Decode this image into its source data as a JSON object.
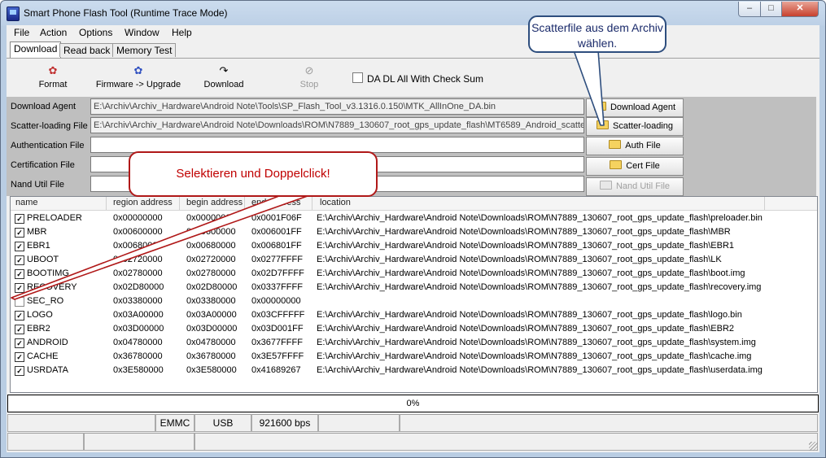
{
  "window": {
    "title": "Smart Phone Flash Tool (Runtime Trace Mode)",
    "controls": {
      "minimize": "–",
      "maximize": "□",
      "close": "✕"
    }
  },
  "menu": [
    "File",
    "Action",
    "Options",
    "Window",
    "Help"
  ],
  "tabs": [
    {
      "label": "Download",
      "active": true
    },
    {
      "label": "Read back",
      "active": false
    },
    {
      "label": "Memory Test",
      "active": false
    }
  ],
  "toolbar": {
    "format": "Format",
    "firmware_upgrade": "Firmware -> Upgrade",
    "download": "Download",
    "stop": "Stop",
    "checksum_label": "DA DL All With Check Sum",
    "checksum_checked": false
  },
  "files": {
    "download_agent": {
      "label": "Download Agent",
      "value": "E:\\Archiv\\Archiv_Hardware\\Android Note\\Tools\\SP_Flash_Tool_v3.1316.0.150\\MTK_AllInOne_DA.bin",
      "button": "Download Agent"
    },
    "scatter": {
      "label": "Scatter-loading File",
      "value": "E:\\Archiv\\Archiv_Hardware\\Android Note\\Downloads\\ROM\\N7889_130607_root_gps_update_flash\\MT6589_Android_scatte",
      "button": "Scatter-loading"
    },
    "auth": {
      "label": "Authentication File",
      "value": "",
      "button": "Auth File"
    },
    "cert": {
      "label": "Certification File",
      "value": "",
      "button": "Cert File"
    },
    "nand": {
      "label": "Nand Util File",
      "value": "",
      "button": "Nand Util File"
    }
  },
  "list": {
    "columns": [
      "name",
      "region address",
      "begin address",
      "end address",
      "location"
    ],
    "rows": [
      {
        "checked": true,
        "name": "PRELOADER",
        "region": "0x00000000",
        "begin": "0x00000000",
        "end": "0x0001F06F",
        "location": "E:\\Archiv\\Archiv_Hardware\\Android Note\\Downloads\\ROM\\N7889_130607_root_gps_update_flash\\preloader.bin"
      },
      {
        "checked": true,
        "name": "MBR",
        "region": "0x00600000",
        "begin": "0x00600000",
        "end": "0x006001FF",
        "location": "E:\\Archiv\\Archiv_Hardware\\Android Note\\Downloads\\ROM\\N7889_130607_root_gps_update_flash\\MBR"
      },
      {
        "checked": true,
        "name": "EBR1",
        "region": "0x00680000",
        "begin": "0x00680000",
        "end": "0x006801FF",
        "location": "E:\\Archiv\\Archiv_Hardware\\Android Note\\Downloads\\ROM\\N7889_130607_root_gps_update_flash\\EBR1"
      },
      {
        "checked": true,
        "name": "UBOOT",
        "region": "0x02720000",
        "begin": "0x02720000",
        "end": "0x0277FFFF",
        "location": "E:\\Archiv\\Archiv_Hardware\\Android Note\\Downloads\\ROM\\N7889_130607_root_gps_update_flash\\LK"
      },
      {
        "checked": true,
        "name": "BOOTIMG",
        "region": "0x02780000",
        "begin": "0x02780000",
        "end": "0x02D7FFFF",
        "location": "E:\\Archiv\\Archiv_Hardware\\Android Note\\Downloads\\ROM\\N7889_130607_root_gps_update_flash\\boot.img"
      },
      {
        "checked": true,
        "name": "RECOVERY",
        "region": "0x02D80000",
        "begin": "0x02D80000",
        "end": "0x0337FFFF",
        "location": "E:\\Archiv\\Archiv_Hardware\\Android Note\\Downloads\\ROM\\N7889_130607_root_gps_update_flash\\recovery.img"
      },
      {
        "checked": false,
        "name": "SEC_RO",
        "region": "0x03380000",
        "begin": "0x03380000",
        "end": "0x00000000",
        "location": ""
      },
      {
        "checked": true,
        "name": "LOGO",
        "region": "0x03A00000",
        "begin": "0x03A00000",
        "end": "0x03CFFFFF",
        "location": "E:\\Archiv\\Archiv_Hardware\\Android Note\\Downloads\\ROM\\N7889_130607_root_gps_update_flash\\logo.bin"
      },
      {
        "checked": true,
        "name": "EBR2",
        "region": "0x03D00000",
        "begin": "0x03D00000",
        "end": "0x03D001FF",
        "location": "E:\\Archiv\\Archiv_Hardware\\Android Note\\Downloads\\ROM\\N7889_130607_root_gps_update_flash\\EBR2"
      },
      {
        "checked": true,
        "name": "ANDROID",
        "region": "0x04780000",
        "begin": "0x04780000",
        "end": "0x3677FFFF",
        "location": "E:\\Archiv\\Archiv_Hardware\\Android Note\\Downloads\\ROM\\N7889_130607_root_gps_update_flash\\system.img"
      },
      {
        "checked": true,
        "name": "CACHE",
        "region": "0x36780000",
        "begin": "0x36780000",
        "end": "0x3E57FFFF",
        "location": "E:\\Archiv\\Archiv_Hardware\\Android Note\\Downloads\\ROM\\N7889_130607_root_gps_update_flash\\cache.img"
      },
      {
        "checked": true,
        "name": "USRDATA",
        "region": "0x3E580000",
        "begin": "0x3E580000",
        "end": "0x41689267",
        "location": "E:\\Archiv\\Archiv_Hardware\\Android Note\\Downloads\\ROM\\N7889_130607_root_gps_update_flash\\userdata.img"
      }
    ]
  },
  "progress": {
    "text": "0%",
    "value": 0
  },
  "status": {
    "storage": "EMMC",
    "port": "USB",
    "baud": "921600 bps"
  },
  "annotations": {
    "select_callout": "Selektieren und Doppelclick!",
    "scatter_callout": "Scatterfile aus dem Archiv wählen."
  },
  "colors": {
    "callout_red": "#c00000",
    "callout_blue": "#2e4e7e",
    "checkmark": "#000000"
  },
  "icons": {
    "format": "format-icon",
    "firmware": "firmware-upgrade-icon",
    "download": "download-icon",
    "stop": "stop-icon",
    "folder": "folder-icon"
  }
}
